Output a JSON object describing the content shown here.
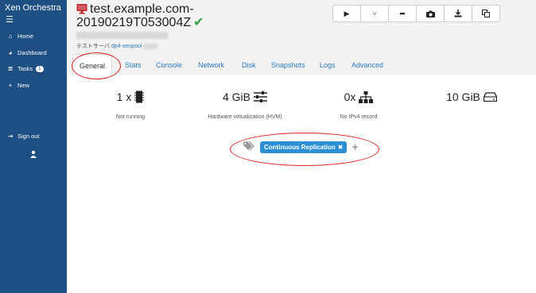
{
  "sidebar": {
    "brand": "Xen Orchestra",
    "items": [
      {
        "label": "Home",
        "icon": "home-icon"
      },
      {
        "label": "Dashboard",
        "icon": "dashboard-icon"
      },
      {
        "label": "Tasks",
        "icon": "tasks-icon",
        "badge": "1"
      },
      {
        "label": "New",
        "icon": "plus-icon"
      }
    ],
    "signout": "Sign out"
  },
  "vm": {
    "name_line1": "test.example.com-",
    "name_line2": "20190219T053004Z",
    "subtitle_prefix": "テストサーバ",
    "pool": "dp4-xenpool",
    "status_color": "#2ea64c"
  },
  "toolbar": {
    "buttons": [
      "play-icon",
      "pause-icon",
      "forward-icon",
      "camera-icon",
      "download-icon",
      "copy-icon"
    ]
  },
  "tabs": [
    "General",
    "Stats",
    "Console",
    "Network",
    "Disk",
    "Snapshots",
    "Logs",
    "Advanced"
  ],
  "stats": [
    {
      "value": "1 x",
      "label": "Not running",
      "icon": "cpu-icon"
    },
    {
      "value": "4 GiB",
      "label": "Hardware virtualization (HVM)",
      "icon": "sliders-icon"
    },
    {
      "value": "0x",
      "label": "No IPv4 record",
      "icon": "network-icon"
    },
    {
      "value": "10 GiB",
      "label": "",
      "icon": "disk-icon"
    }
  ],
  "tags": [
    "Continuous Replication"
  ],
  "colors": {
    "sidebar": "#1d4f83",
    "accent": "#2b78c2",
    "tag": "#2b8fd6",
    "annotation": "#e02020"
  }
}
